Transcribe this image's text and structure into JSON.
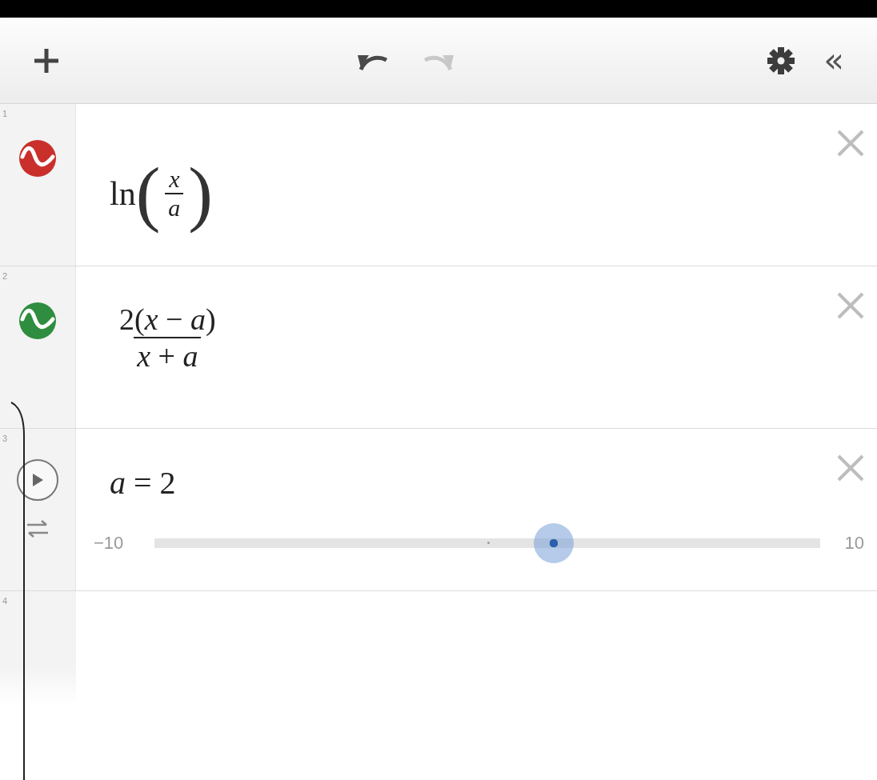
{
  "toolbar": {
    "undo": {
      "disabled": false
    },
    "redo": {
      "disabled": true
    },
    "collapse": "«"
  },
  "expressions": [
    {
      "index": "1",
      "kind": "function-call",
      "color": "#c9302c",
      "func": "ln",
      "left_paren": "(",
      "numerator": "x",
      "denominator": "a",
      "right_paren": ")"
    },
    {
      "index": "2",
      "kind": "fraction",
      "color": "#2f8d3f",
      "numerator": "2(*x* − *a*)",
      "denominator": "*x* + *a*"
    },
    {
      "index": "3",
      "kind": "slider",
      "text": "*a* = 2",
      "min": "−10",
      "max": "10",
      "level": 0.6
    },
    {
      "index": "4",
      "kind": "empty"
    }
  ]
}
